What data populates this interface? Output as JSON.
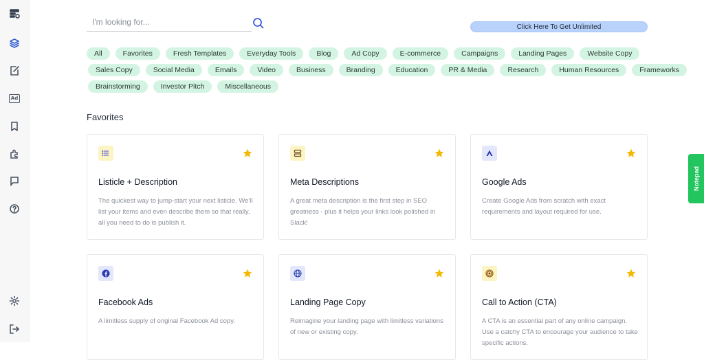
{
  "search": {
    "placeholder": "I'm looking for..."
  },
  "unlimited_label": "Click Here To Get Unlimited",
  "categories": [
    [
      "All",
      "Favorites",
      "Fresh Templates",
      "Everyday Tools",
      "Blog",
      "Ad Copy",
      "E-commerce",
      "Campaigns",
      "Landing Pages",
      "Website Copy"
    ],
    [
      "Sales Copy",
      "Social Media",
      "Emails",
      "Video",
      "Business",
      "Branding",
      "Education",
      "PR & Media",
      "Research",
      "Human Resources",
      "Frameworks"
    ],
    [
      "Brainstorming",
      "Investor Pitch",
      "Miscellaneous"
    ]
  ],
  "section_title": "Favorites",
  "cards": [
    {
      "title": "Listicle + Description",
      "desc": "The quickest way to jump-start your next listicle. We'll list your items and even describe them so that really, all you need to do is publish it.",
      "icon": "list-icon",
      "badge_color": "#fdf4c4"
    },
    {
      "title": "Meta Descriptions",
      "desc": "A great meta description is the first step in SEO greatness - plus it helps your links look polished in Slack!",
      "icon": "server-icon",
      "badge_color": "#fdf4c4"
    },
    {
      "title": "Google Ads",
      "desc": "Create Google Ads from scratch with exact requirements and layout required for use.",
      "icon": "google-ads-icon",
      "badge_color": "#e3e7fb"
    },
    {
      "title": "Facebook Ads",
      "desc": "A limitless supply of original Facebook Ad copy.",
      "icon": "facebook-icon",
      "badge_color": "#e3e7fb"
    },
    {
      "title": "Landing Page Copy",
      "desc": "Reimagine your landing page with limitless variations of new or existing copy.",
      "icon": "globe-icon",
      "badge_color": "#e3e7fb"
    },
    {
      "title": "Call to Action (CTA)",
      "desc": "A CTA is an essential part of any online campaign. Use a catchy CTA to encourage your audience to take specific actions.",
      "icon": "target-icon",
      "badge_color": "#fdf4c4"
    }
  ],
  "notepad_label": "Notepad",
  "colors": {
    "accent": "#2f5bd3",
    "chip_bg": "#d4f4e3",
    "star": "#f5b800",
    "notepad": "#22c55e"
  }
}
